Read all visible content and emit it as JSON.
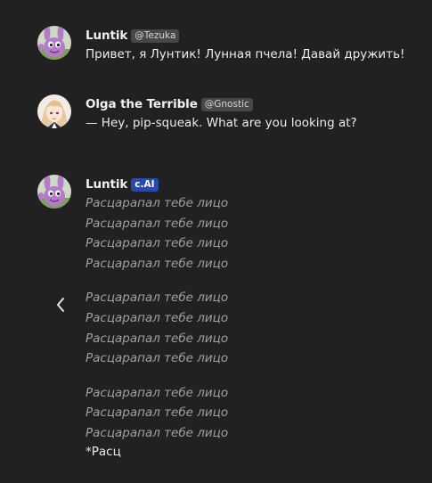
{
  "messages": [
    {
      "author": "Luntik",
      "tag": "@Tezuka",
      "text": "Привет, я Лунтик! Лунная пчела! Давай дружить!"
    },
    {
      "author": "Olga the Terrible",
      "tag": "@Gnostic",
      "text": "— Hey, pip-squeak. What are you looking at?"
    },
    {
      "author": "Luntik",
      "tag": "c.AI",
      "groups": [
        [
          "Расцарапал тебе лицо",
          "Расцарапал тебе лицо",
          "Расцарапал тебе лицо",
          "Расцарапал тебе лицо"
        ],
        [
          "Расцарапал тебе лицо",
          "Расцарапал тебе лицо",
          "Расцарапал тебе лицо",
          "Расцарапал тебе лицо"
        ],
        [
          "Расцарапал тебе лицо",
          "Расцарапал тебе лицо",
          "Расцарапал тебе лицо"
        ]
      ],
      "last_line": "*Расц"
    }
  ],
  "icons": {
    "prev": "chevron-left-icon"
  },
  "colors": {
    "background": "#212121",
    "cai_badge": "#2b4aa8",
    "tag_badge": "#474747",
    "italic_text": "#a0a0a0"
  }
}
